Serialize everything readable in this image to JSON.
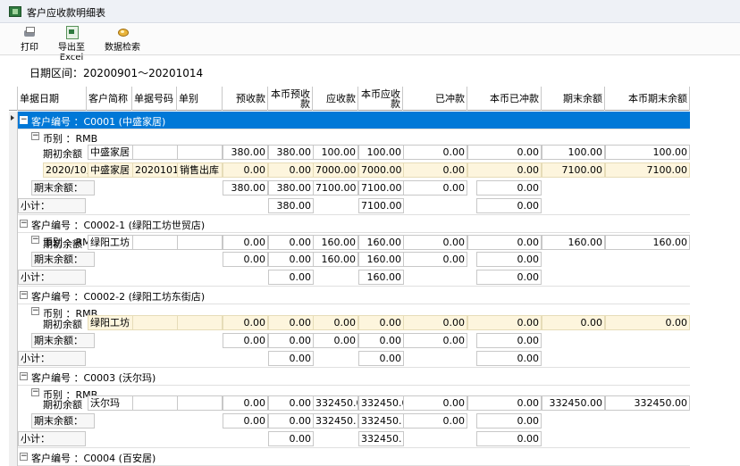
{
  "window": {
    "title": "客户应收款明细表"
  },
  "toolbar": {
    "print_label": "打印",
    "export_label": "导出至Excel",
    "search_label": "数据检索"
  },
  "filter": {
    "date_range": "日期区间：20200901～20201014"
  },
  "columns": [
    "单据日期",
    "客户简称",
    "单据号码",
    "单别",
    "预收款",
    "本币预收款",
    "应收款",
    "本币应收款",
    "已冲款",
    "本币已冲款",
    "期末余额",
    "本币期末余额"
  ],
  "rows": {
    "g1": "客户编号 ：C0001 (中盛家居)",
    "g1_cur": "币别 ：RMB",
    "g1_r1": [
      "期初余额",
      "中盛家居",
      "",
      "",
      "380.00",
      "380.00",
      "100.00",
      "100.00",
      "0.00",
      "0.00",
      "100.00",
      "100.00"
    ],
    "g1_r2": [
      "2020/10,",
      "中盛家居",
      "20201010",
      "销售出库",
      "0.00",
      "0.00",
      "7000.00",
      "7000.00",
      "0.00",
      "0.00",
      "7100.00",
      "7100.00"
    ],
    "g1_end_label": "期末余额：",
    "g1_end": [
      "380.00",
      "380.00",
      "7100.00",
      "7100.00",
      "0.00",
      "0.00"
    ],
    "g1_sub_label": "小计：",
    "g1_sub": [
      "380.00",
      "7100.00",
      "0.00"
    ],
    "g2": "客户编号 ：C0002-1 (绿阳工坊世贸店)",
    "g2_cur": "币别 ：RMB",
    "g2_r1": [
      "期初余额",
      "绿阳工坊",
      "",
      "",
      "0.00",
      "0.00",
      "160.00",
      "160.00",
      "0.00",
      "0.00",
      "160.00",
      "160.00"
    ],
    "g2_end_label": "期末余额：",
    "g2_end": [
      "0.00",
      "0.00",
      "160.00",
      "160.00",
      "0.00",
      "0.00"
    ],
    "g2_sub_label": "小计：",
    "g2_sub": [
      "0.00",
      "160.00",
      "0.00"
    ],
    "g3": "客户编号 ：C0002-2 (绿阳工坊东街店)",
    "g3_cur": "币别 ：RMB",
    "g3_r1": [
      "期初余额",
      "绿阳工坊",
      "",
      "",
      "0.00",
      "0.00",
      "0.00",
      "0.00",
      "0.00",
      "0.00",
      "0.00",
      "0.00"
    ],
    "g3_end_label": "期末余额：",
    "g3_end": [
      "0.00",
      "0.00",
      "0.00",
      "0.00",
      "0.00",
      "0.00"
    ],
    "g3_sub_label": "小计：",
    "g3_sub": [
      "0.00",
      "0.00",
      "0.00"
    ],
    "g4": "客户编号 ：C0003 (沃尔玛)",
    "g4_cur": "币别 ：RMB",
    "g4_r1": [
      "期初余额",
      "沃尔玛",
      "",
      "",
      "0.00",
      "0.00",
      "332450.0",
      "332450.0",
      "0.00",
      "0.00",
      "332450.00",
      "332450.00"
    ],
    "g4_end_label": "期末余额：",
    "g4_end": [
      "0.00",
      "0.00",
      "332450.",
      "332450.",
      "0.00",
      "0.00"
    ],
    "g4_sub_label": "小计：",
    "g4_sub": [
      "0.00",
      "332450.",
      "0.00"
    ],
    "g5": "客户编号 ：C0004 (百安居)"
  },
  "colors": {
    "selected_row": "#0078d7",
    "yellow_cell": "#fdf5dd"
  }
}
